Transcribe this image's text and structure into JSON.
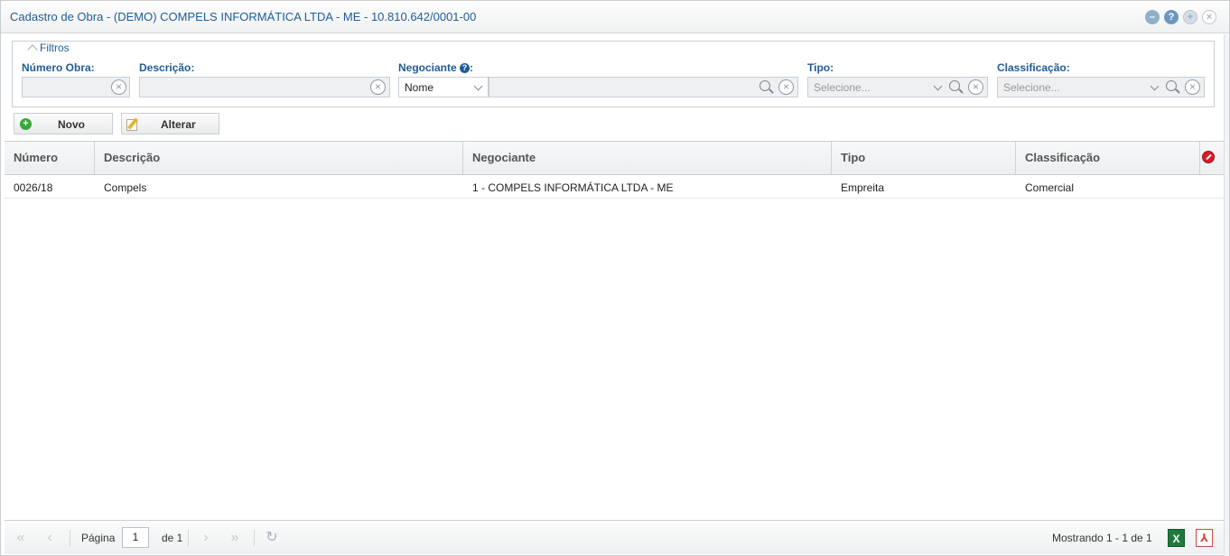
{
  "window": {
    "title": "Cadastro de Obra - (DEMO) COMPELS INFORMÁTICA LTDA - ME - 10.810.642/0001-00"
  },
  "filters": {
    "legend": "Filtros",
    "numero_obra": {
      "label": "Número Obra:",
      "value": ""
    },
    "descricao": {
      "label": "Descrição:",
      "value": ""
    },
    "negociante": {
      "label": "Negociante",
      "label_suffix": ":",
      "type_selected": "Nome",
      "value": ""
    },
    "tipo": {
      "label": "Tipo:",
      "placeholder": "Selecione..."
    },
    "classificacao": {
      "label": "Classificação:",
      "placeholder": "Selecione..."
    }
  },
  "toolbar": {
    "novo_label": "Novo",
    "alterar_label": "Alterar"
  },
  "grid": {
    "columns": [
      "Número",
      "Descrição",
      "Negociante",
      "Tipo",
      "Classificação"
    ],
    "rows": [
      {
        "numero": "0026/18",
        "descricao": "Compels",
        "negociante": "1 - COMPELS INFORMÁTICA LTDA - ME",
        "tipo": "Empreita",
        "classificacao": "Comercial"
      }
    ]
  },
  "pager": {
    "page_label": "Página",
    "page_value": "1",
    "of_label": "de 1",
    "status": "Mostrando 1 - 1 de 1"
  },
  "colors": {
    "title_blue": "#1f5c98",
    "accent_green": "#3aa63a",
    "excel_green": "#1d7a3b",
    "pdf_red": "#d64541"
  }
}
